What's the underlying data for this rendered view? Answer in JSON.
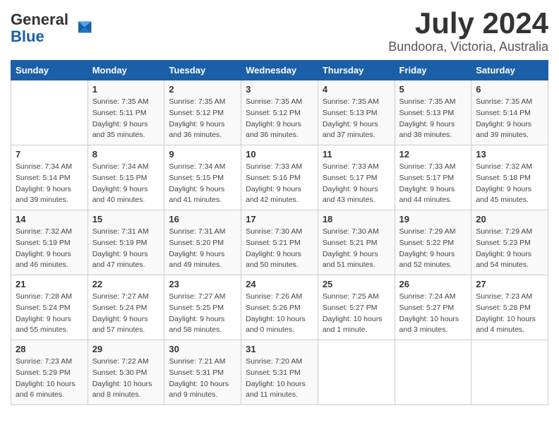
{
  "logo": {
    "text_general": "General",
    "text_blue": "Blue"
  },
  "header": {
    "month": "July 2024",
    "location": "Bundoora, Victoria, Australia"
  },
  "days_of_week": [
    "Sunday",
    "Monday",
    "Tuesday",
    "Wednesday",
    "Thursday",
    "Friday",
    "Saturday"
  ],
  "weeks": [
    [
      {
        "day": "",
        "info": ""
      },
      {
        "day": "1",
        "info": "Sunrise: 7:35 AM\nSunset: 5:11 PM\nDaylight: 9 hours\nand 35 minutes."
      },
      {
        "day": "2",
        "info": "Sunrise: 7:35 AM\nSunset: 5:12 PM\nDaylight: 9 hours\nand 36 minutes."
      },
      {
        "day": "3",
        "info": "Sunrise: 7:35 AM\nSunset: 5:12 PM\nDaylight: 9 hours\nand 36 minutes."
      },
      {
        "day": "4",
        "info": "Sunrise: 7:35 AM\nSunset: 5:13 PM\nDaylight: 9 hours\nand 37 minutes."
      },
      {
        "day": "5",
        "info": "Sunrise: 7:35 AM\nSunset: 5:13 PM\nDaylight: 9 hours\nand 38 minutes."
      },
      {
        "day": "6",
        "info": "Sunrise: 7:35 AM\nSunset: 5:14 PM\nDaylight: 9 hours\nand 39 minutes."
      }
    ],
    [
      {
        "day": "7",
        "info": "Sunrise: 7:34 AM\nSunset: 5:14 PM\nDaylight: 9 hours\nand 39 minutes."
      },
      {
        "day": "8",
        "info": "Sunrise: 7:34 AM\nSunset: 5:15 PM\nDaylight: 9 hours\nand 40 minutes."
      },
      {
        "day": "9",
        "info": "Sunrise: 7:34 AM\nSunset: 5:15 PM\nDaylight: 9 hours\nand 41 minutes."
      },
      {
        "day": "10",
        "info": "Sunrise: 7:33 AM\nSunset: 5:16 PM\nDaylight: 9 hours\nand 42 minutes."
      },
      {
        "day": "11",
        "info": "Sunrise: 7:33 AM\nSunset: 5:17 PM\nDaylight: 9 hours\nand 43 minutes."
      },
      {
        "day": "12",
        "info": "Sunrise: 7:33 AM\nSunset: 5:17 PM\nDaylight: 9 hours\nand 44 minutes."
      },
      {
        "day": "13",
        "info": "Sunrise: 7:32 AM\nSunset: 5:18 PM\nDaylight: 9 hours\nand 45 minutes."
      }
    ],
    [
      {
        "day": "14",
        "info": "Sunrise: 7:32 AM\nSunset: 5:19 PM\nDaylight: 9 hours\nand 46 minutes."
      },
      {
        "day": "15",
        "info": "Sunrise: 7:31 AM\nSunset: 5:19 PM\nDaylight: 9 hours\nand 47 minutes."
      },
      {
        "day": "16",
        "info": "Sunrise: 7:31 AM\nSunset: 5:20 PM\nDaylight: 9 hours\nand 49 minutes."
      },
      {
        "day": "17",
        "info": "Sunrise: 7:30 AM\nSunset: 5:21 PM\nDaylight: 9 hours\nand 50 minutes."
      },
      {
        "day": "18",
        "info": "Sunrise: 7:30 AM\nSunset: 5:21 PM\nDaylight: 9 hours\nand 51 minutes."
      },
      {
        "day": "19",
        "info": "Sunrise: 7:29 AM\nSunset: 5:22 PM\nDaylight: 9 hours\nand 52 minutes."
      },
      {
        "day": "20",
        "info": "Sunrise: 7:29 AM\nSunset: 5:23 PM\nDaylight: 9 hours\nand 54 minutes."
      }
    ],
    [
      {
        "day": "21",
        "info": "Sunrise: 7:28 AM\nSunset: 5:24 PM\nDaylight: 9 hours\nand 55 minutes."
      },
      {
        "day": "22",
        "info": "Sunrise: 7:27 AM\nSunset: 5:24 PM\nDaylight: 9 hours\nand 57 minutes."
      },
      {
        "day": "23",
        "info": "Sunrise: 7:27 AM\nSunset: 5:25 PM\nDaylight: 9 hours\nand 58 minutes."
      },
      {
        "day": "24",
        "info": "Sunrise: 7:26 AM\nSunset: 5:26 PM\nDaylight: 10 hours\nand 0 minutes."
      },
      {
        "day": "25",
        "info": "Sunrise: 7:25 AM\nSunset: 5:27 PM\nDaylight: 10 hours\nand 1 minute."
      },
      {
        "day": "26",
        "info": "Sunrise: 7:24 AM\nSunset: 5:27 PM\nDaylight: 10 hours\nand 3 minutes."
      },
      {
        "day": "27",
        "info": "Sunrise: 7:23 AM\nSunset: 5:28 PM\nDaylight: 10 hours\nand 4 minutes."
      }
    ],
    [
      {
        "day": "28",
        "info": "Sunrise: 7:23 AM\nSunset: 5:29 PM\nDaylight: 10 hours\nand 6 minutes."
      },
      {
        "day": "29",
        "info": "Sunrise: 7:22 AM\nSunset: 5:30 PM\nDaylight: 10 hours\nand 8 minutes."
      },
      {
        "day": "30",
        "info": "Sunrise: 7:21 AM\nSunset: 5:31 PM\nDaylight: 10 hours\nand 9 minutes."
      },
      {
        "day": "31",
        "info": "Sunrise: 7:20 AM\nSunset: 5:31 PM\nDaylight: 10 hours\nand 11 minutes."
      },
      {
        "day": "",
        "info": ""
      },
      {
        "day": "",
        "info": ""
      },
      {
        "day": "",
        "info": ""
      }
    ]
  ]
}
